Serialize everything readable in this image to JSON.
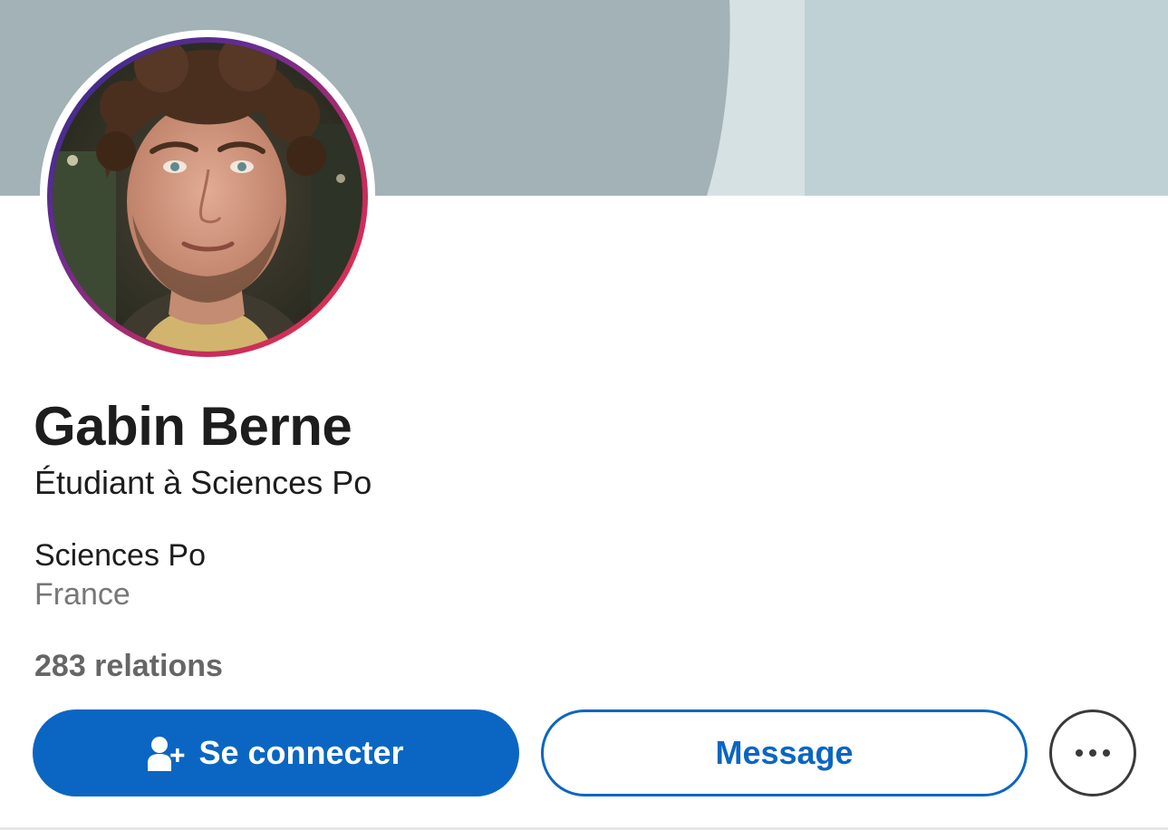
{
  "profile": {
    "name": "Gabin Berne",
    "headline": "Étudiant à Sciences Po",
    "school": "Sciences Po",
    "location": "France",
    "connections": "283 relations"
  },
  "actions": {
    "connect_label": "Se connecter",
    "connect_icon": "add-person-icon",
    "message_label": "Message",
    "more_icon": "ellipsis-icon"
  },
  "colors": {
    "primary": "#0a66c2",
    "banner_main": "#a2b2b6",
    "banner_light": "#d6e1e4",
    "banner_right": "#bfd1d5",
    "avatar_ring_start": "#2b2a8c",
    "avatar_ring_end": "#e8354a"
  }
}
